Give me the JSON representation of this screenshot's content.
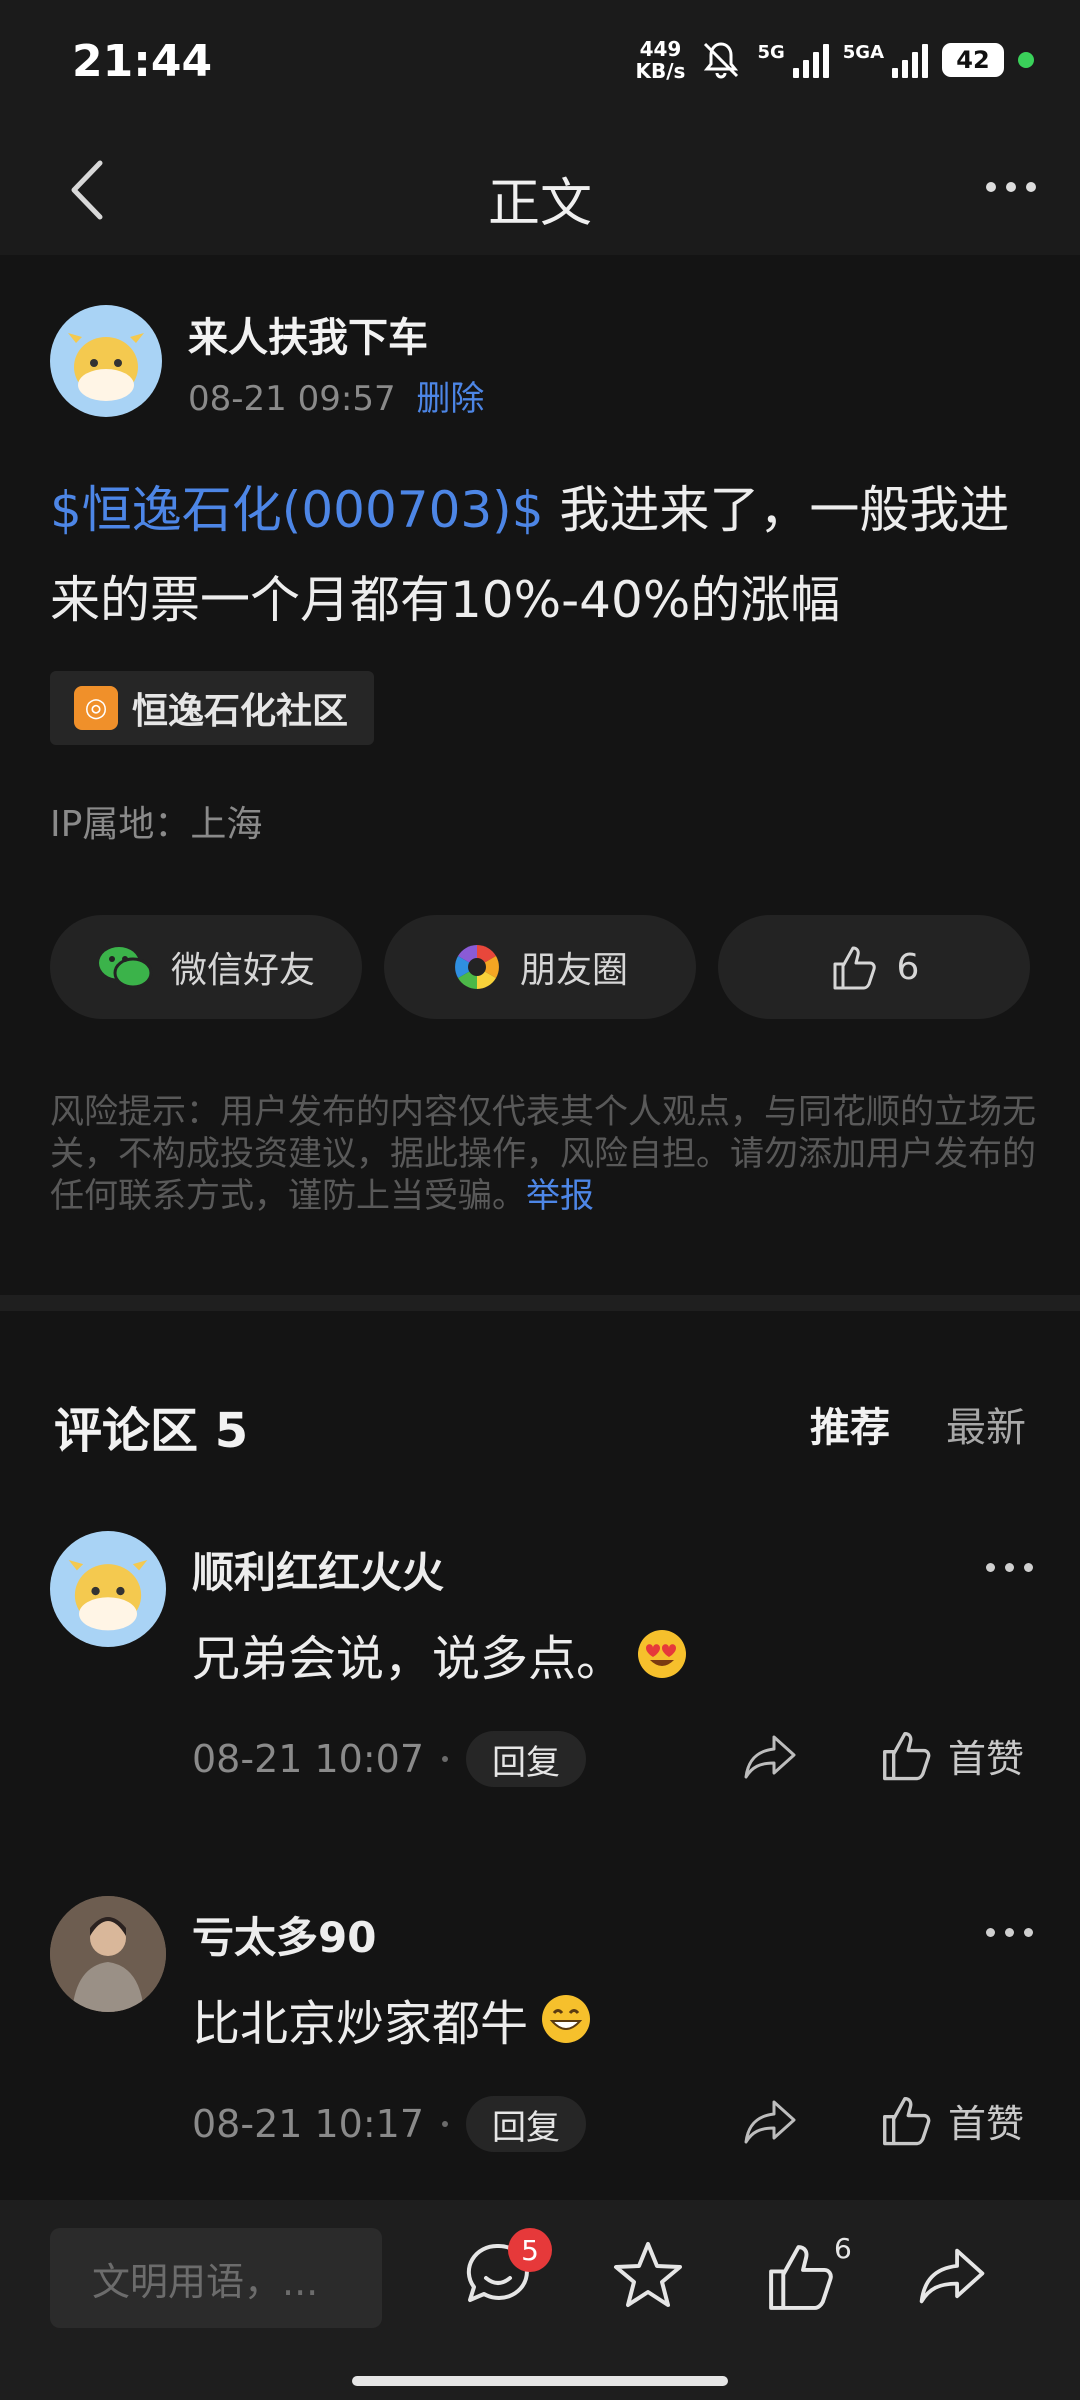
{
  "status_bar": {
    "time": "21:44",
    "net_speed_value": "449",
    "net_speed_unit": "KB/s",
    "sim1": "5G",
    "sim2": "5GA",
    "battery": "42"
  },
  "header": {
    "title": "正文"
  },
  "post": {
    "author": "来人扶我下车",
    "datetime": "08-21 09:57",
    "delete_label": "删除",
    "stock_tag": "$恒逸石化(000703)$",
    "text": " 我进来了，一般我进来的票一个月都有10%-40%的涨幅",
    "community_tag": "恒逸石化社区",
    "ip_location": "IP属地：上海",
    "share": {
      "wechat_label": "微信好友",
      "moments_label": "朋友圈",
      "like_count": "6"
    },
    "risk_notice": "风险提示：用户发布的内容仅代表其个人观点，与同花顺的立场无关，不构成投资建议，据此操作，风险自担。请勿添加用户发布的任何联系方式，谨防上当受骗。",
    "report_label": "举报"
  },
  "comments": {
    "header": "评论区 5",
    "sort_recommend": "推荐",
    "sort_latest": "最新",
    "items": [
      {
        "name": "顺利红红火火",
        "text": "兄弟会说，说多点。",
        "emoji": "heart-eyes-emoji",
        "datetime": "08-21 10:07",
        "reply_label": "回复",
        "like_label": "首赞"
      },
      {
        "name": "亏太多90",
        "text": "比北京炒家都牛",
        "emoji": "grin-emoji",
        "datetime": "08-21 10:17",
        "reply_label": "回复",
        "like_label": "首赞"
      }
    ]
  },
  "bottom_bar": {
    "input_placeholder": "文明用语，...",
    "comment_badge": "5",
    "like_count": "6"
  },
  "colors": {
    "accent_blue": "#4d86e6",
    "badge_red": "#e6393a",
    "background": "#141414",
    "community_orange": "#f0902a"
  }
}
